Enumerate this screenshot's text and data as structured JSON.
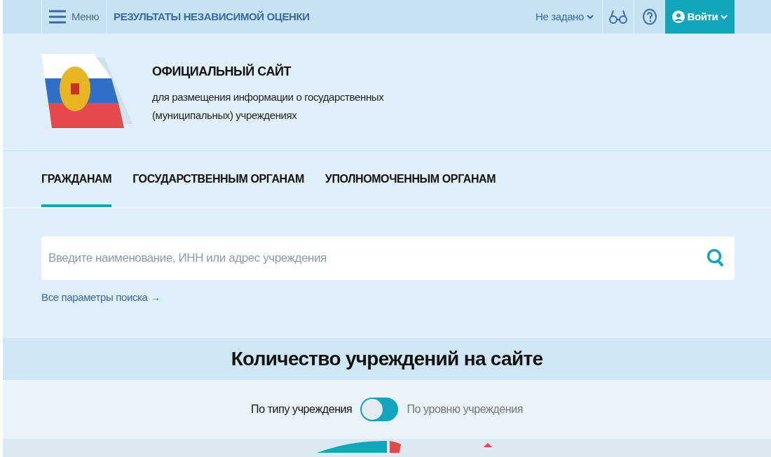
{
  "top_bar": {
    "menu_label": "Меню",
    "title": "РЕЗУЛЬТАТЫ НЕЗАВИСИМОЙ ОЦЕНКИ",
    "region": "Не задано",
    "login": "Войти"
  },
  "header": {
    "title": "ОФИЦИАЛЬНЫЙ САЙТ",
    "subtitle_lines": [
      "для размещения информации о государственных",
      "(муниципальных) учреждениях"
    ]
  },
  "tabs": [
    {
      "label": "ГРАЖДАНАМ",
      "selected": true
    },
    {
      "label": "ГОСУДАРСТВЕННЫМ ОРГАНАМ",
      "selected": false
    },
    {
      "label": "УПОЛНОМОЧЕННЫМ ОРГАНАМ",
      "selected": false
    }
  ],
  "search": {
    "placeholder": "Введите наименование, ИНН или адрес учреждения",
    "advanced_link": "Все параметры поиска →"
  },
  "stats": {
    "title": "Количество учреждений на сайте",
    "toggle": {
      "left_label": "По типу учреждения",
      "right_label": "По уровню учреждения",
      "on": false
    }
  }
}
